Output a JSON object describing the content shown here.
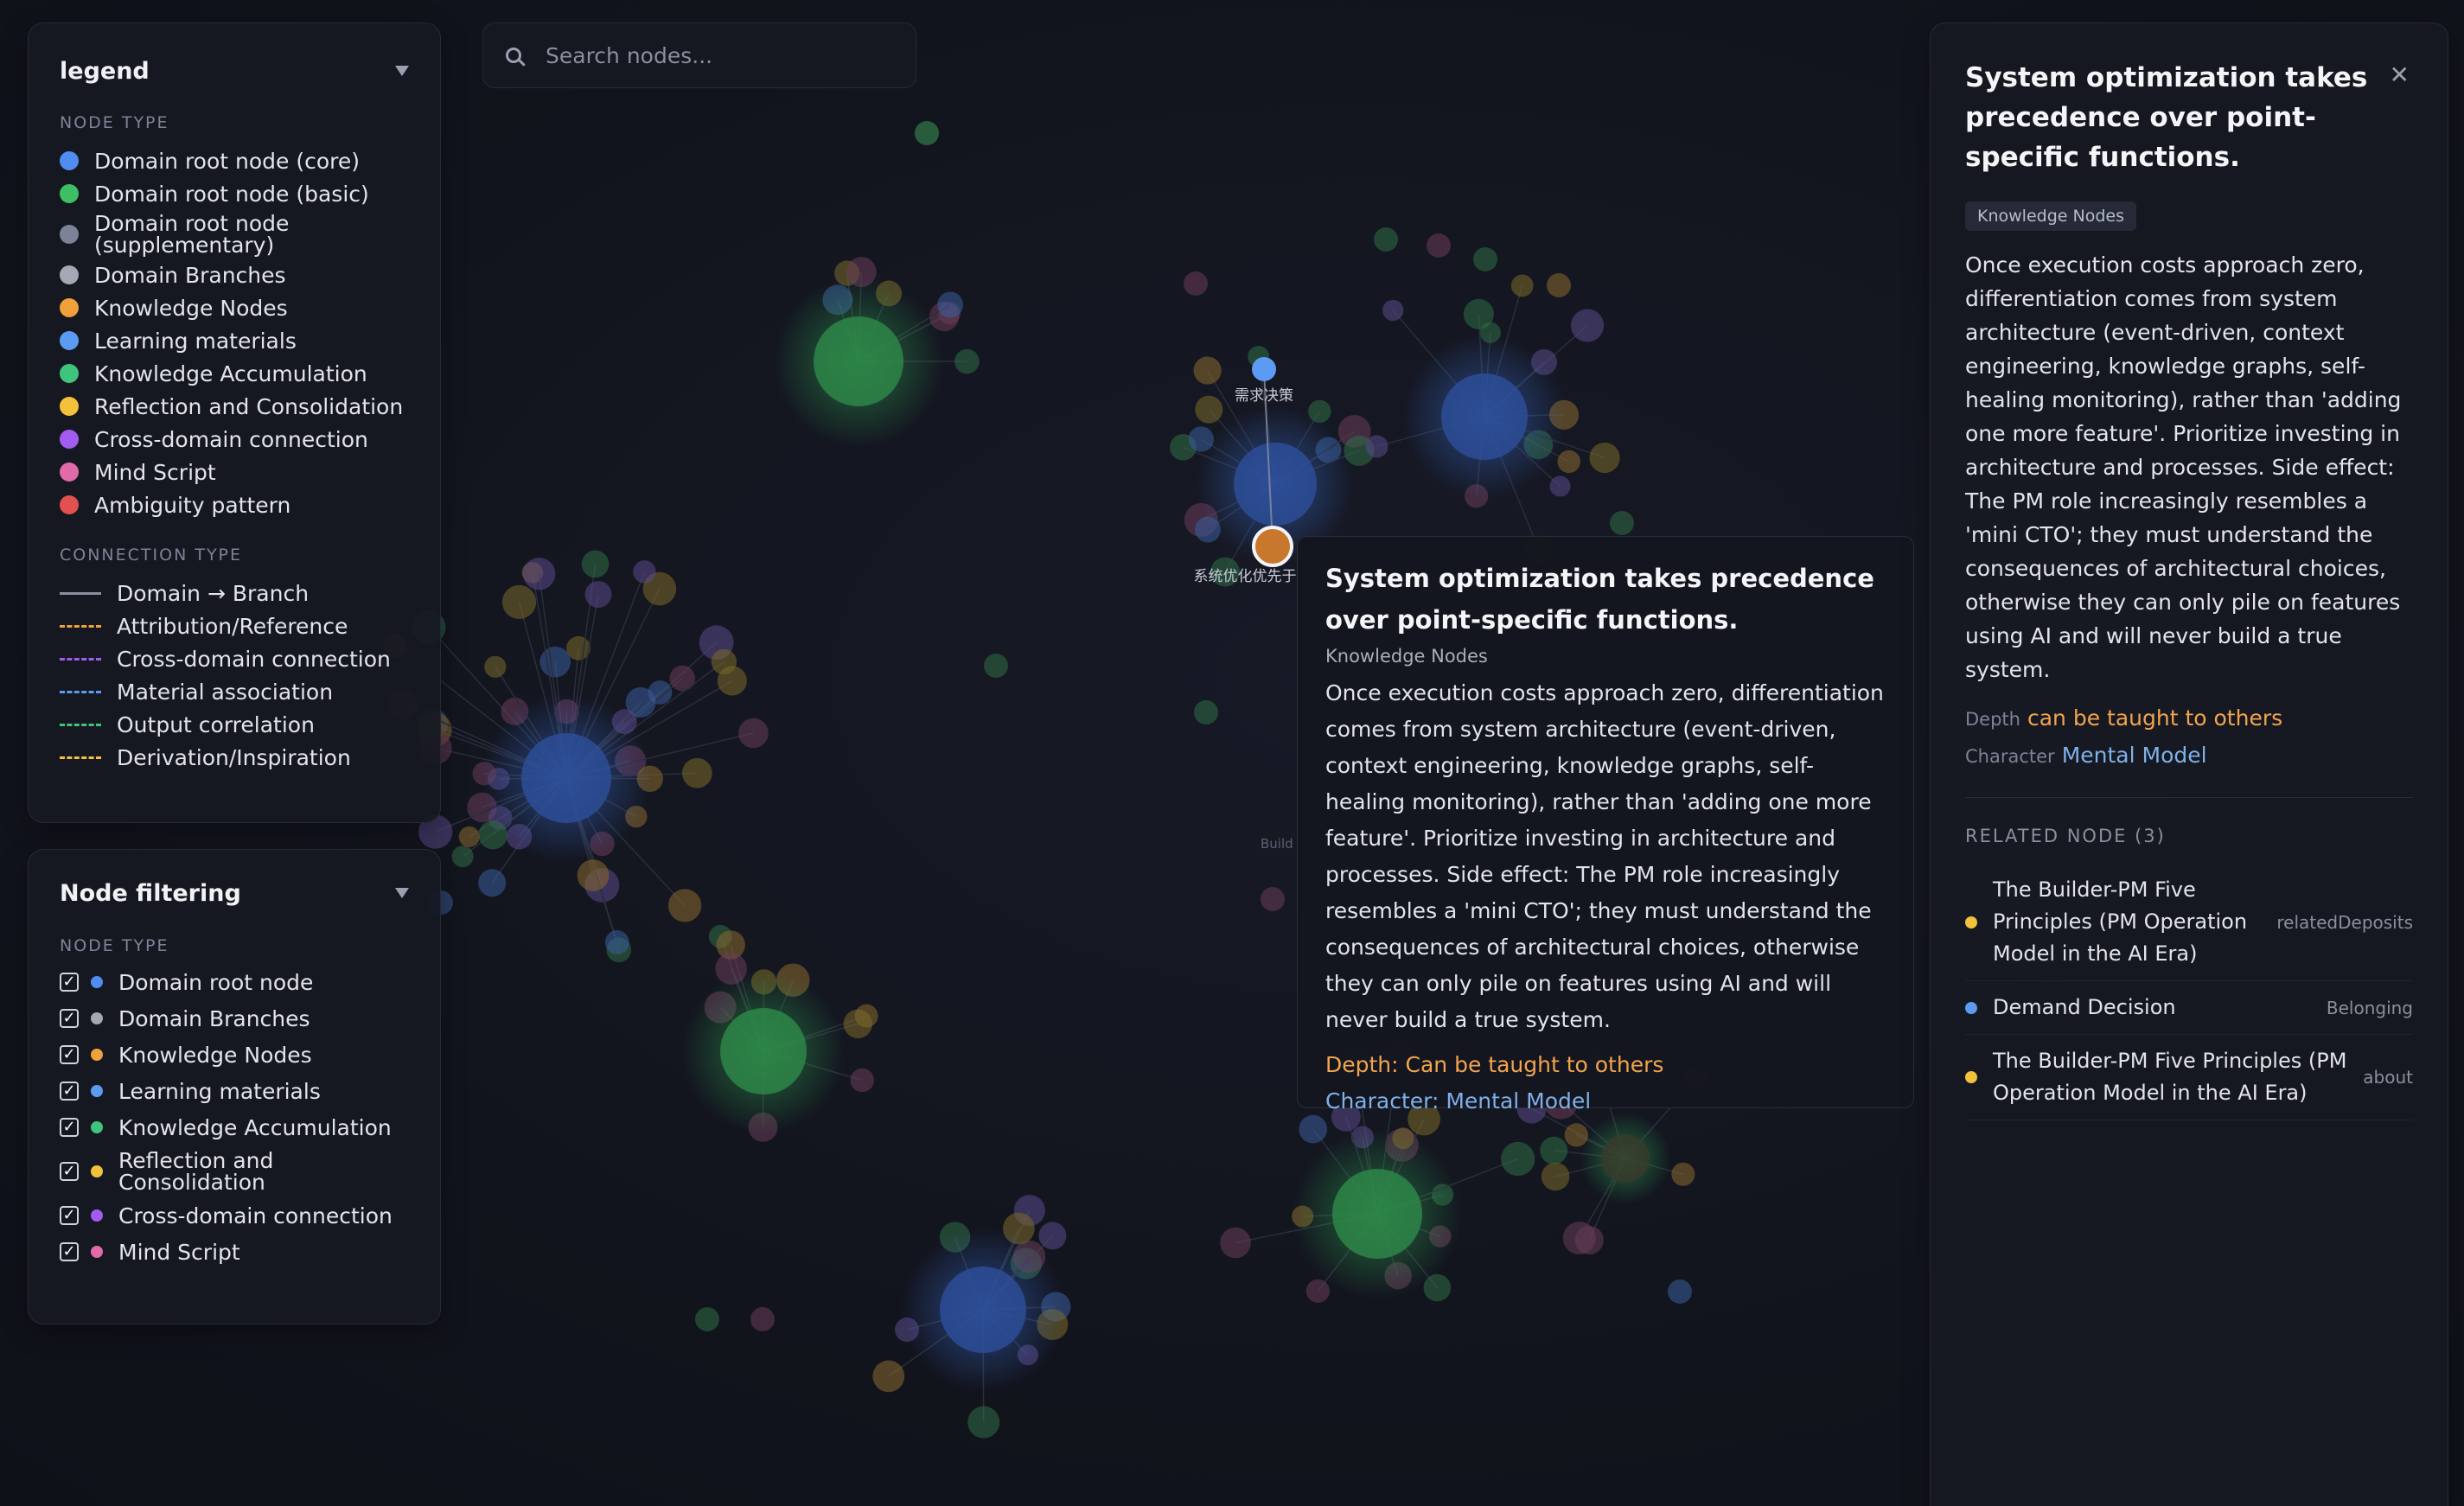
{
  "search": {
    "placeholder": "Search nodes..."
  },
  "legend": {
    "title": "legend",
    "node_type_label": "NODE TYPE",
    "node_types": [
      {
        "label": "Domain root node (core)",
        "color": "#4f8df0"
      },
      {
        "label": "Domain root node (basic)",
        "color": "#3fbf63"
      },
      {
        "label": "Domain root node (supplementary)",
        "color": "#7d8396"
      },
      {
        "label": "Domain Branches",
        "color": "#a3a8b4"
      },
      {
        "label": "Knowledge Nodes",
        "color": "#f0a13b"
      },
      {
        "label": "Learning materials",
        "color": "#5b9cf2"
      },
      {
        "label": "Knowledge Accumulation",
        "color": "#40c47d"
      },
      {
        "label": "Reflection and Consolidation",
        "color": "#f3c23a"
      },
      {
        "label": "Cross-domain connection",
        "color": "#a35cf0"
      },
      {
        "label": "Mind Script",
        "color": "#e26aa8"
      },
      {
        "label": "Ambiguity pattern",
        "color": "#e2504f"
      }
    ],
    "connection_type_label": "CONNECTION TYPE",
    "connection_types": [
      {
        "label": "Domain → Branch",
        "color": "#8a8f9e",
        "style": "solid"
      },
      {
        "label": "Attribution/Reference",
        "color": "#f0a13b",
        "style": "dashed"
      },
      {
        "label": "Cross-domain connection",
        "color": "#a35cf0",
        "style": "dashed"
      },
      {
        "label": "Material association",
        "color": "#5b9cf2",
        "style": "dashed"
      },
      {
        "label": "Output correlation",
        "color": "#40c47d",
        "style": "dashed"
      },
      {
        "label": "Derivation/Inspiration",
        "color": "#f3c23a",
        "style": "dashed"
      }
    ]
  },
  "filter": {
    "title": "Node filtering",
    "node_type_label": "NODE TYPE",
    "items": [
      {
        "label": "Domain root node",
        "color": "#4f8df0",
        "checked": true
      },
      {
        "label": "Domain Branches",
        "color": "#a3a8b4",
        "checked": true
      },
      {
        "label": "Knowledge Nodes",
        "color": "#f0a13b",
        "checked": true
      },
      {
        "label": "Learning materials",
        "color": "#5b9cf2",
        "checked": true
      },
      {
        "label": "Knowledge Accumulation",
        "color": "#40c47d",
        "checked": true
      },
      {
        "label": "Reflection and Consolidation",
        "color": "#f3c23a",
        "checked": true
      },
      {
        "label": "Cross-domain connection",
        "color": "#a35cf0",
        "checked": true
      },
      {
        "label": "Mind Script",
        "color": "#e26aa8",
        "checked": true
      }
    ]
  },
  "graph": {
    "labels": {
      "demand": "需求决策",
      "selected": "系统优化优先于",
      "build": "Build"
    }
  },
  "tooltip": {
    "title": "System optimization takes precedence over point-specific functions.",
    "tag": "Knowledge Nodes",
    "body": "Once execution costs approach zero, differentiation comes from system architecture (event-driven, context engineering, knowledge graphs, self-healing monitoring), rather than 'adding one more feature'. Prioritize investing in architecture and processes. Side effect: The PM role increasingly resembles a 'mini CTO'; they must understand the consequences of architectural choices, otherwise they can only pile on features using AI and will never build a true system.",
    "depth_line": "Depth: Can be taught to others",
    "character_line": "Character: Mental Model"
  },
  "details": {
    "title": "System optimization takes precedence over point-specific functions.",
    "tag": "Knowledge Nodes",
    "body": "Once execution costs approach zero, differentiation comes from system architecture (event-driven, context engineering, knowledge graphs, self-healing monitoring), rather than 'adding one more feature'. Prioritize investing in architecture and processes. Side effect: The PM role increasingly resembles a 'mini CTO'; they must understand the consequences of architectural choices, otherwise they can only pile on features using AI and will never build a true system.",
    "depth_key": "Depth",
    "depth_value": "can be taught to others",
    "character_key": "Character",
    "character_value": "Mental Model",
    "related_heading": "RELATED NODE (3)",
    "related": [
      {
        "title": "The Builder-PM Five Principles (PM Operation Model in the AI Era)",
        "relation": "relatedDeposits",
        "color": "#f3c23a"
      },
      {
        "title": "Demand Decision",
        "relation": "Belonging",
        "color": "#5b9cf2"
      },
      {
        "title": "The Builder-PM Five Principles (PM Operation Model in the AI Era)",
        "relation": "about",
        "color": "#f3c23a"
      }
    ]
  }
}
